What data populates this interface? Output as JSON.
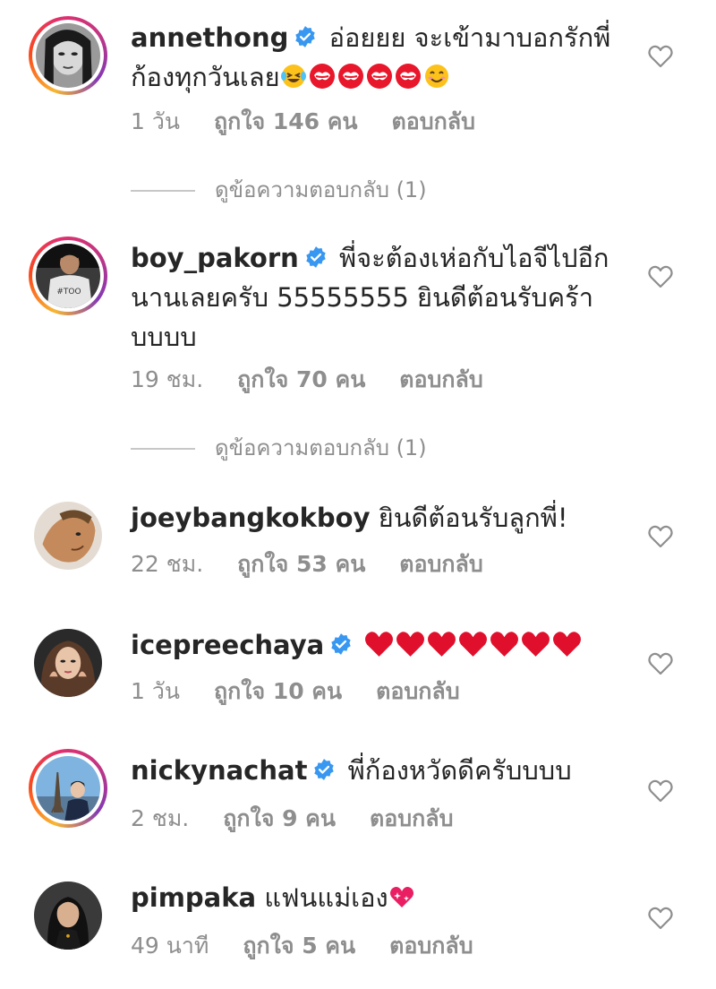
{
  "colors": {
    "text": "#262626",
    "muted": "#8e8e8e",
    "verified": "#3897f0",
    "heart_outline": "#8e8e8e",
    "red_heart": "#e0102c"
  },
  "comments": [
    {
      "username": "annethong",
      "verified": true,
      "story_ring": true,
      "text_line1": "อ่อยยย จะเข้ามาบอกรักพี่",
      "text_line2": "ก้องทุกวันเลย",
      "emoji_icons": [
        "laughing-tears-emoji",
        "kiss-mark-emoji",
        "kiss-mark-emoji",
        "kiss-mark-emoji",
        "kiss-mark-emoji",
        "smiling-emoji"
      ],
      "time": "1 วัน",
      "likes": "ถูกใจ 146 คน",
      "reply": "ตอบกลับ"
    },
    {
      "username": "boy_pakorn",
      "verified": true,
      "story_ring": true,
      "text_line1": "พี่จะต้องเห่อกับไอจีไปอีก",
      "text_line2": "นานเลยครับ 55555555 ยินดีต้อนรับคร้า",
      "text_line3": "บบบบ",
      "time": "19 ชม.",
      "likes": "ถูกใจ 70 คน",
      "reply": "ตอบกลับ"
    },
    {
      "username": "joeybangkokboy",
      "verified": false,
      "story_ring": false,
      "text_line1": "ยินดีต้อนรับลูกพี่!",
      "time": "22 ชม.",
      "likes": "ถูกใจ 53 คน",
      "reply": "ตอบกลับ"
    },
    {
      "username": "icepreechaya",
      "verified": true,
      "story_ring": false,
      "emoji_icons": [
        "red-heart-emoji",
        "red-heart-emoji",
        "red-heart-emoji",
        "red-heart-emoji",
        "red-heart-emoji",
        "red-heart-emoji",
        "red-heart-emoji"
      ],
      "time": "1 วัน",
      "likes": "ถูกใจ 10 คน",
      "reply": "ตอบกลับ"
    },
    {
      "username": "nickynachat",
      "verified": true,
      "story_ring": true,
      "text_line1": "พี่ก้องหวัดดีครับบบบ",
      "time": "2 ชม.",
      "likes": "ถูกใจ 9 คน",
      "reply": "ตอบกลับ"
    },
    {
      "username": "pimpaka",
      "verified": false,
      "story_ring": false,
      "text_line1": "แฟนแม่เอง",
      "emoji_icons": [
        "sparkling-heart-emoji"
      ],
      "time": "49 นาที",
      "likes": "ถูกใจ 5 คน",
      "reply": "ตอบกลับ"
    }
  ],
  "view_replies": [
    {
      "label": "ดูข้อความตอบกลับ (1)"
    },
    {
      "label": "ดูข้อความตอบกลับ (1)"
    }
  ]
}
